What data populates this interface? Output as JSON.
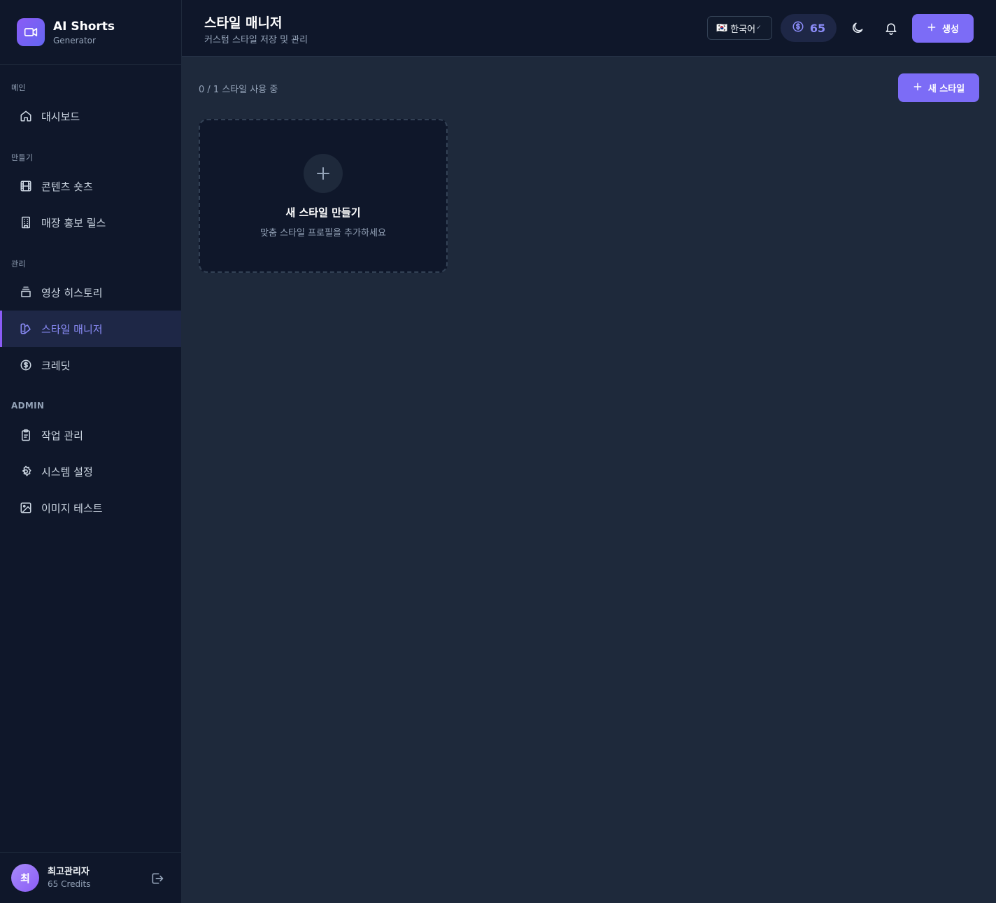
{
  "brand": {
    "title": "AI Shorts",
    "subtitle": "Generator"
  },
  "sidebar": {
    "sections": [
      {
        "label": "메인"
      },
      {
        "label": "만들기"
      },
      {
        "label": "관리"
      },
      {
        "label": "ADMIN"
      }
    ],
    "items": [
      {
        "label": "대시보드",
        "icon": "home-icon"
      },
      {
        "label": "콘텐츠 숏츠",
        "icon": "film-icon"
      },
      {
        "label": "매장 홍보 릴스",
        "icon": "building-icon"
      },
      {
        "label": "영상 히스토리",
        "icon": "archive-icon"
      },
      {
        "label": "스타일 매니저",
        "icon": "palette-icon",
        "active": true
      },
      {
        "label": "크레딧",
        "icon": "dollar-icon"
      },
      {
        "label": "작업 관리",
        "icon": "clipboard-icon"
      },
      {
        "label": "시스템 설정",
        "icon": "gear-icon"
      },
      {
        "label": "이미지 테스트",
        "icon": "image-icon"
      }
    ]
  },
  "user": {
    "avatar": "최",
    "name": "최고관리자",
    "credits": "65 Credits"
  },
  "header": {
    "title": "스타일 매니저",
    "subtitle": "커스텀 스타일 저장 및 관리",
    "language": {
      "flag": "🇰🇷",
      "value": "한국어"
    },
    "credits": "65",
    "create_label": "생성"
  },
  "main": {
    "usage": "0 / 1 스타일 사용 중",
    "new_style_label": "새 스타일",
    "card": {
      "title": "새 스타일 만들기",
      "subtitle": "맞춤 스타일 프로필을 추가하세요"
    }
  },
  "colors": {
    "accent": "#7c6cf6",
    "sidebar_bg": "#0f172a",
    "main_bg": "#1e293b",
    "active_text": "#8b8cf8"
  }
}
